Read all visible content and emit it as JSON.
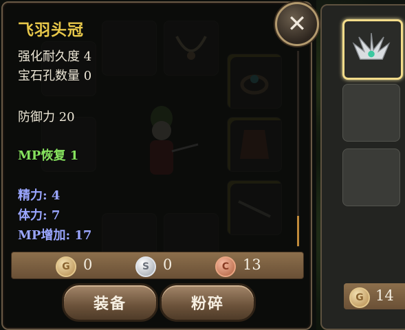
{
  "item": {
    "name": "飞羽头冠",
    "durability": "强化耐久度 4",
    "gem_slots": "宝石孔数量 0",
    "defense": "防御力 20",
    "mp_regen": "MP恢复 1",
    "spirit": "精力: 4",
    "stamina": "体力: 7",
    "mp_bonus": "MP增加: 17"
  },
  "currency": {
    "gold_glyph": "G",
    "gold": "0",
    "silver_glyph": "S",
    "silver": "0",
    "copper_glyph": "C",
    "copper": "13"
  },
  "buttons": {
    "equip": "装备",
    "smash": "粉碎",
    "close": "✕"
  },
  "side": {
    "coin_glyph": "G",
    "gold_value": "14"
  },
  "colors": {
    "title": "#e8c84a",
    "regen": "#86e35e",
    "stat": "#9aa6ff"
  }
}
